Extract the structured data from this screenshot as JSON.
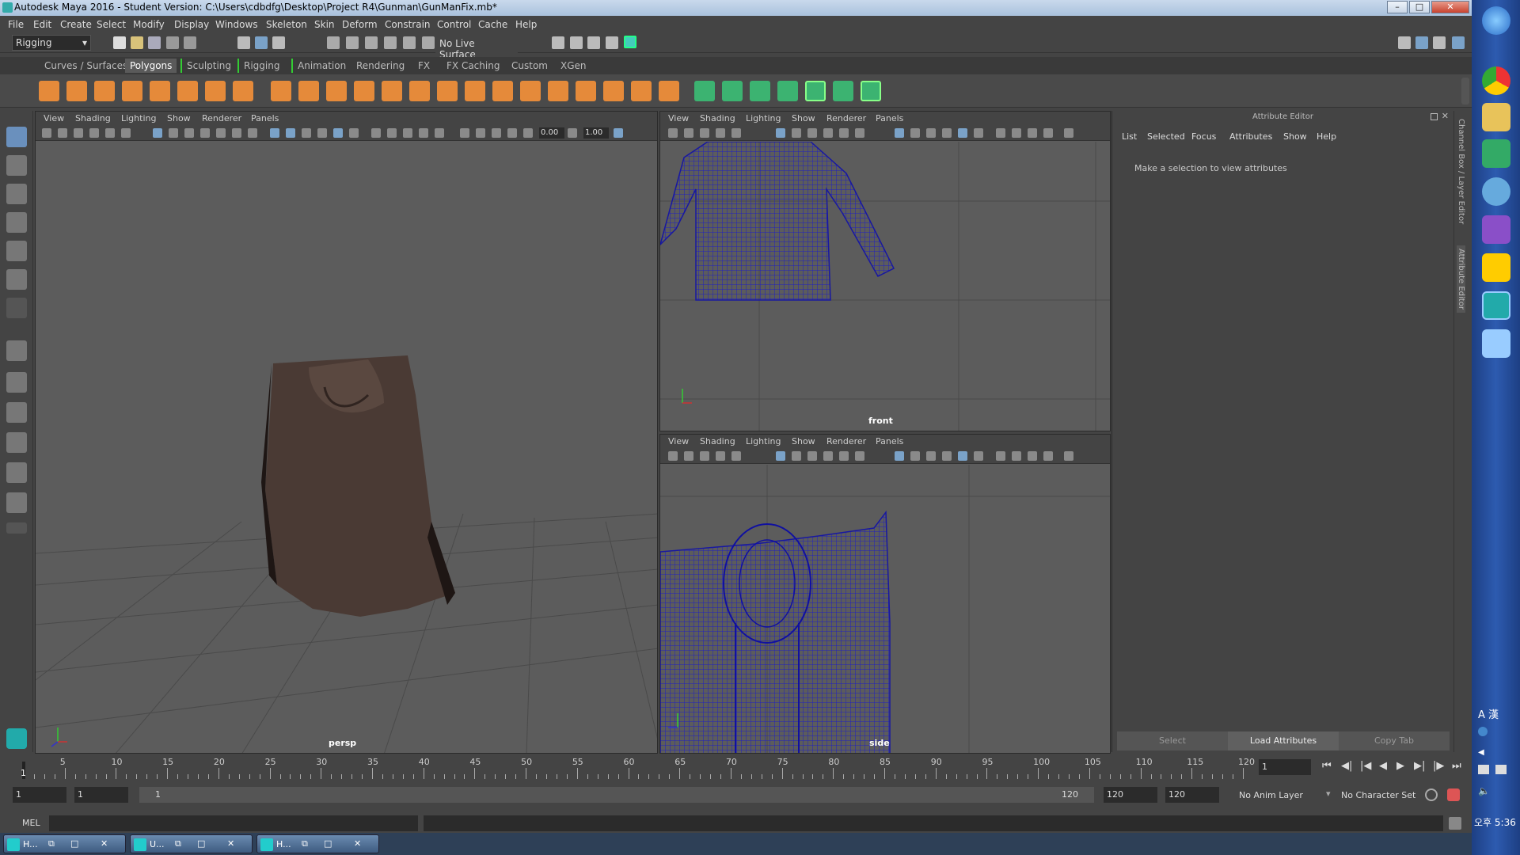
{
  "window": {
    "title": "Autodesk Maya 2016 - Student Version: C:\\Users\\cdbdfg\\Desktop\\Project R4\\Gunman\\GunManFix.mb*"
  },
  "menubar": [
    "File",
    "Edit",
    "Create",
    "Select",
    "Modify",
    "Display",
    "Windows",
    "Skeleton",
    "Skin",
    "Deform",
    "Constrain",
    "Control",
    "Cache",
    "Help"
  ],
  "statusline": {
    "menuset": "Rigging",
    "live_surface": "No Live Surface"
  },
  "shelf_tabs": [
    {
      "label": "Curves / Surfaces",
      "active": false
    },
    {
      "label": "Polygons",
      "active": true
    },
    {
      "label": "Sculpting",
      "active": false
    },
    {
      "label": "Rigging",
      "active": false
    },
    {
      "label": "Animation",
      "active": false
    },
    {
      "label": "Rendering",
      "active": false
    },
    {
      "label": "FX",
      "active": false
    },
    {
      "label": "FX Caching",
      "active": false
    },
    {
      "label": "Custom",
      "active": false
    },
    {
      "label": "XGen",
      "active": false
    }
  ],
  "panel_menu": [
    "View",
    "Shading",
    "Lighting",
    "Show",
    "Renderer",
    "Panels"
  ],
  "viewports": {
    "persp": {
      "label": "persp",
      "near": "0.00",
      "far": "1.00"
    },
    "front": {
      "label": "front"
    },
    "side": {
      "label": "side"
    }
  },
  "attribute_editor": {
    "header": "Attribute Editor",
    "menus": [
      "List",
      "Selected",
      "Focus",
      "Attributes",
      "Show",
      "Help"
    ],
    "message": "Make a selection to view attributes",
    "buttons": {
      "select": "Select",
      "load": "Load Attributes",
      "copy": "Copy Tab"
    },
    "side_tabs": [
      "Channel Box / Layer Editor",
      "Attribute Editor"
    ]
  },
  "timeline": {
    "labels": [
      "5",
      "10",
      "15",
      "20",
      "25",
      "30",
      "35",
      "40",
      "45",
      "50",
      "55",
      "60",
      "65",
      "70",
      "75",
      "80",
      "85",
      "90",
      "95",
      "100",
      "105",
      "110",
      "115",
      "120"
    ],
    "current_frame": "1",
    "current_frame_field": "1"
  },
  "range": {
    "start": "1",
    "playback_start": "1",
    "handle_start": "1",
    "handle_end": "120",
    "playback_end": "120",
    "end": "120",
    "anim_layer": "No Anim Layer",
    "character_set": "No Character Set"
  },
  "cmdline": {
    "label": "MEL"
  },
  "taskbar": {
    "items": [
      "H...",
      "U...",
      "H..."
    ],
    "clock": "오후 5:36"
  },
  "colors": {
    "wireframe": "#2020c0",
    "viewport_bg": "#5c5c5c",
    "ui_bg": "#444444",
    "cloth": "#4a3a34"
  }
}
